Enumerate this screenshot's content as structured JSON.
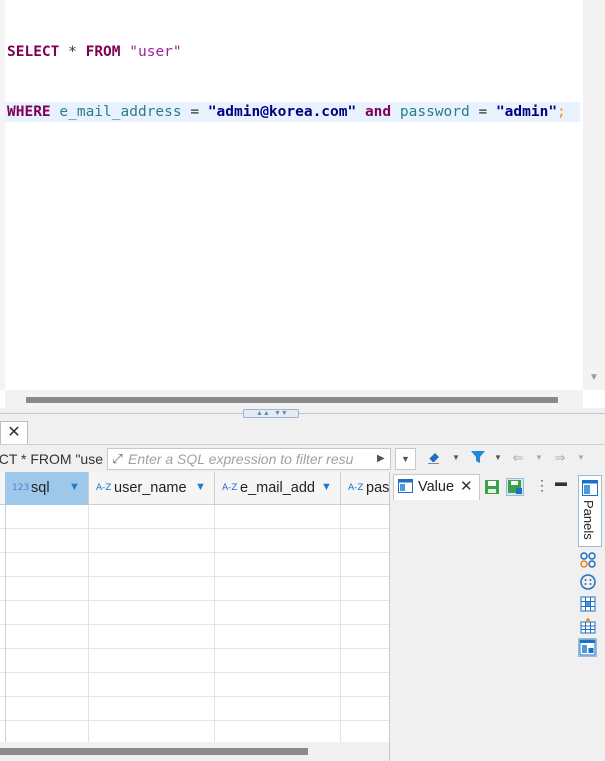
{
  "editor": {
    "lines": [
      {
        "tokens": [
          {
            "t": "SELECT",
            "c": "kw"
          },
          {
            "t": " * ",
            "c": "sym"
          },
          {
            "t": "FROM",
            "c": "kw"
          },
          {
            "t": " ",
            "c": "sym"
          },
          {
            "t": "\"user\"",
            "c": "tbl"
          }
        ]
      },
      {
        "tokens": [
          {
            "t": "WHERE",
            "c": "kw"
          },
          {
            "t": " ",
            "c": "sym"
          },
          {
            "t": "e_mail_address",
            "c": "id"
          },
          {
            "t": " = ",
            "c": "sym"
          },
          {
            "t": "\"admin@korea.com\"",
            "c": "str"
          },
          {
            "t": " ",
            "c": "sym"
          },
          {
            "t": "and",
            "c": "kw"
          },
          {
            "t": " ",
            "c": "sym"
          },
          {
            "t": "password",
            "c": "id"
          },
          {
            "t": " = ",
            "c": "sym"
          },
          {
            "t": "\"admin\"",
            "c": "str"
          },
          {
            "t": ";",
            "c": "semi"
          }
        ]
      }
    ]
  },
  "results": {
    "query_label": "CT * FROM \"use",
    "filter_placeholder": "Enter a SQL expression to filter resu",
    "columns": [
      {
        "name": "sql",
        "type_icon": "number-type-icon",
        "type_label": "123",
        "selected": true
      },
      {
        "name": "user_name",
        "type_icon": "text-type-icon",
        "type_label": "A-Z",
        "selected": false
      },
      {
        "name": "e_mail_add",
        "type_icon": "text-type-icon",
        "type_label": "A-Z",
        "selected": false
      },
      {
        "name": "pas",
        "type_icon": "text-type-icon",
        "type_label": "A-Z",
        "selected": false
      }
    ]
  },
  "value_panel": {
    "tab_label": "Value"
  },
  "side_panel": {
    "panels_label": "Panels"
  },
  "icons": {
    "close": "close-icon",
    "filter": "expand-icon",
    "eraser": "eraser-icon",
    "funnel": "funnel-icon",
    "back": "arrow-left-icon",
    "forward": "arrow-right-icon",
    "save": "save-icon",
    "save_as": "save-as-icon"
  },
  "colors": {
    "keyword": "#7f0055",
    "identifier": "#2a7f7f",
    "string": "#000080",
    "table": "#a020a0",
    "selected_header": "#9ec8ea",
    "accent": "#1f7ad1"
  }
}
